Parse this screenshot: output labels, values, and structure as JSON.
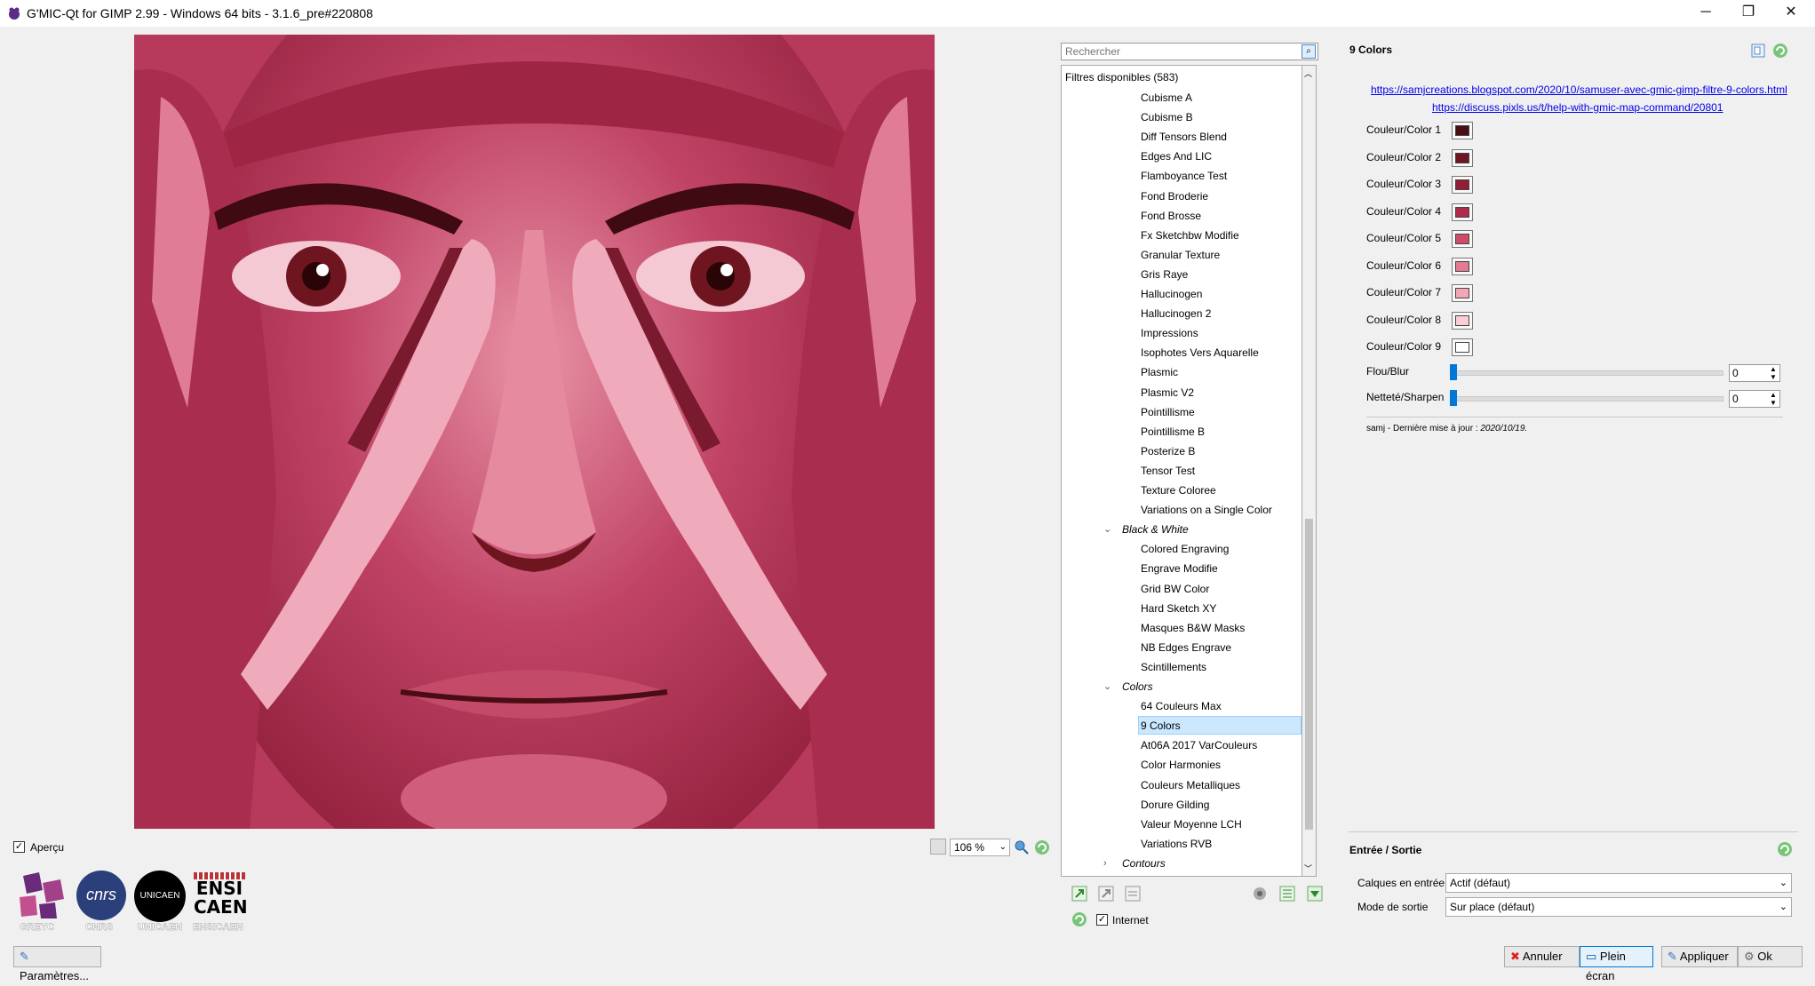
{
  "window": {
    "title": "G'MIC-Qt for GIMP 2.99 - Windows 64 bits - 3.1.6_pre#220808",
    "controls": [
      "─",
      "❐",
      "✕"
    ]
  },
  "preview": {
    "toggle_label": "Aperçu",
    "toggle_checked": true,
    "zoom": "106 %"
  },
  "logos": [
    {
      "text": "GREYC",
      "color": "#6a2a7a"
    },
    {
      "text": "CNRS",
      "color": "#2b3f7a"
    },
    {
      "text": "UNICAEN",
      "color": "#000000"
    },
    {
      "text": "ENSICAEN",
      "color": "#111111"
    }
  ],
  "logo_marks": {
    "cnrs": "cnrs",
    "unicaen": "UNICAEN",
    "ensicaen": [
      "ENSI",
      "CAEN"
    ]
  },
  "settings_button": "Paramètres...",
  "search": {
    "placeholder": "Rechercher"
  },
  "filters": {
    "header": "Filtres disponibles (583)",
    "items": [
      {
        "label": "Cubisme A",
        "level": 2
      },
      {
        "label": "Cubisme B",
        "level": 2
      },
      {
        "label": "Diff Tensors Blend",
        "level": 2
      },
      {
        "label": "Edges And LIC",
        "level": 2
      },
      {
        "label": "Flamboyance Test",
        "level": 2
      },
      {
        "label": "Fond Broderie",
        "level": 2
      },
      {
        "label": "Fond Brosse",
        "level": 2
      },
      {
        "label": "Fx Sketchbw Modifie",
        "level": 2
      },
      {
        "label": "Granular Texture",
        "level": 2
      },
      {
        "label": "Gris Raye",
        "level": 2
      },
      {
        "label": "Hallucinogen",
        "level": 2
      },
      {
        "label": "Hallucinogen 2",
        "level": 2
      },
      {
        "label": "Impressions",
        "level": 2
      },
      {
        "label": "Isophotes Vers Aquarelle",
        "level": 2
      },
      {
        "label": "Plasmic",
        "level": 2
      },
      {
        "label": "Plasmic V2",
        "level": 2
      },
      {
        "label": "Pointillisme",
        "level": 2
      },
      {
        "label": "Pointillisme B",
        "level": 2
      },
      {
        "label": "Posterize B",
        "level": 2
      },
      {
        "label": "Tensor Test",
        "level": 2
      },
      {
        "label": "Texture Coloree",
        "level": 2
      },
      {
        "label": "Variations on a Single Color",
        "level": 2
      },
      {
        "label": "Black & White",
        "level": 1,
        "category": true,
        "expanded": true
      },
      {
        "label": "Colored Engraving",
        "level": 2
      },
      {
        "label": "Engrave Modifie",
        "level": 2
      },
      {
        "label": "Grid BW Color",
        "level": 2
      },
      {
        "label": "Hard Sketch XY",
        "level": 2
      },
      {
        "label": "Masques B&W Masks",
        "level": 2
      },
      {
        "label": "NB Edges Engrave",
        "level": 2
      },
      {
        "label": "Scintillements",
        "level": 2
      },
      {
        "label": "Colors",
        "level": 1,
        "category": true,
        "expanded": true
      },
      {
        "label": "64 Couleurs Max",
        "level": 2
      },
      {
        "label": "9 Colors",
        "level": 2,
        "selected": true
      },
      {
        "label": "At06A 2017 VarCouleurs",
        "level": 2
      },
      {
        "label": "Color Harmonies",
        "level": 2
      },
      {
        "label": "Couleurs Metalliques",
        "level": 2
      },
      {
        "label": "Dorure Gilding",
        "level": 2
      },
      {
        "label": "Valeur Moyenne LCH",
        "level": 2
      },
      {
        "label": "Variations RVB",
        "level": 2
      },
      {
        "label": "Contours",
        "level": 1,
        "category": true,
        "expanded": false
      }
    ],
    "internet_label": "Internet",
    "internet_checked": true
  },
  "params": {
    "title": "9 Colors",
    "links": [
      "https://samjcreations.blogspot.com/2020/10/samuser-avec-gmic-gimp-filtre-9-colors.html",
      "https://discuss.pixls.us/t/help-with-gmic-map-command/20801"
    ],
    "colors": [
      {
        "label": "Couleur/Color 1",
        "hex": "#4a0d14"
      },
      {
        "label": "Couleur/Color 2",
        "hex": "#6e1520"
      },
      {
        "label": "Couleur/Color 3",
        "hex": "#921d34"
      },
      {
        "label": "Couleur/Color 4",
        "hex": "#b12a4c"
      },
      {
        "label": "Couleur/Color 5",
        "hex": "#cc4d6a"
      },
      {
        "label": "Couleur/Color 6",
        "hex": "#e27a90"
      },
      {
        "label": "Couleur/Color 7",
        "hex": "#f2a6b6"
      },
      {
        "label": "Couleur/Color 8",
        "hex": "#fbcdd6"
      },
      {
        "label": "Couleur/Color 9",
        "hex": "#ffffff"
      }
    ],
    "sliders": [
      {
        "label": "Flou/Blur",
        "value": "0",
        "fraction": 0
      },
      {
        "label": "Netteté/Sharpen",
        "value": "0",
        "fraction": 0
      }
    ],
    "author_prefix": "samj - Dernière mise à jour : ",
    "author_date": "2020/10/19."
  },
  "io": {
    "title": "Entrée / Sortie",
    "input_label": "Calques en entrée",
    "input_value": "Actif (défaut)",
    "output_label": "Mode de sortie",
    "output_value": "Sur place (défaut)"
  },
  "buttons": {
    "cancel": "Annuler",
    "fullscreen": "Plein écran",
    "apply": "Appliquer",
    "ok": "Ok"
  },
  "accent": "#0078d7",
  "selection_color": "#cce8ff"
}
